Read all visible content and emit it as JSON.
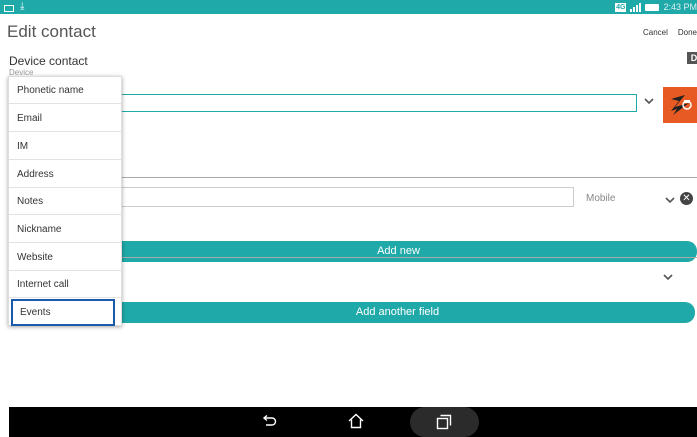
{
  "status_bar": {
    "left_icons": [
      "mail-icon",
      "download-icon"
    ],
    "network": "4G",
    "time": "2:43 PM"
  },
  "app_bar": {
    "title": "Edit contact",
    "cancel_label": "Cancel",
    "done_label": "Done"
  },
  "account": {
    "name": "Device contact",
    "type": "Device",
    "corner_icon_text": "D"
  },
  "phone": {
    "type_label": "Mobile"
  },
  "buttons": {
    "add_new": "Add new",
    "add_another_field": "Add another field"
  },
  "field_menu": {
    "items": [
      "Phonetic name",
      "Email",
      "IM",
      "Address",
      "Notes",
      "Nickname",
      "Website",
      "Internet call",
      "Events"
    ],
    "focused_item": "Events"
  },
  "colors": {
    "accent": "#1fa9a8",
    "photo": "#e85a24",
    "focus": "#1a5aa8",
    "nav_bar": "#000000"
  }
}
